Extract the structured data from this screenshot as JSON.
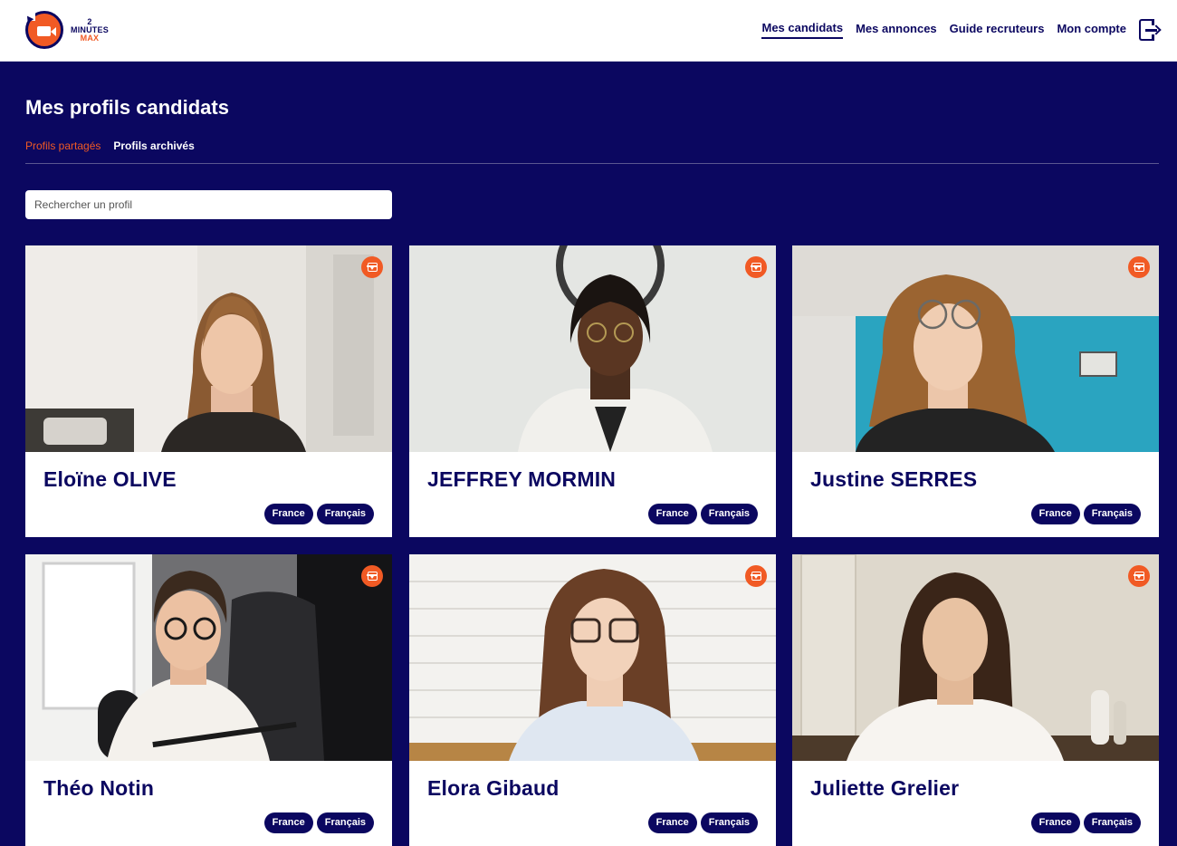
{
  "brand": {
    "logo_top": "2",
    "logo_mid": "MINUTES",
    "logo_bottom": "MAX",
    "accent": "#f15a24",
    "navy": "#0b0760"
  },
  "nav": {
    "items": [
      {
        "label": "Mes candidats",
        "active": true
      },
      {
        "label": "Mes annonces",
        "active": false
      },
      {
        "label": "Guide recruteurs",
        "active": false
      },
      {
        "label": "Mon compte",
        "active": false
      }
    ],
    "logout_icon": "logout-icon"
  },
  "page": {
    "title": "Mes profils candidats",
    "tabs": [
      {
        "label": "Profils partagés",
        "active": true
      },
      {
        "label": "Profils archivés",
        "active": false
      }
    ]
  },
  "search": {
    "placeholder": "Rechercher un profil",
    "value": ""
  },
  "candidates": [
    {
      "name": "Eloïne OLIVE",
      "tags": [
        "France",
        "Français"
      ],
      "archive_icon": "archive-icon"
    },
    {
      "name": "JEFFREY MORMIN",
      "tags": [
        "France",
        "Français"
      ],
      "archive_icon": "archive-icon"
    },
    {
      "name": "Justine SERRES",
      "tags": [
        "France",
        "Français"
      ],
      "archive_icon": "archive-icon"
    },
    {
      "name": "Théo Notin",
      "tags": [
        "France",
        "Français"
      ],
      "archive_icon": "archive-icon"
    },
    {
      "name": "Elora Gibaud",
      "tags": [
        "France",
        "Français"
      ],
      "archive_icon": "archive-icon"
    },
    {
      "name": "Juliette Grelier",
      "tags": [
        "France",
        "Français"
      ],
      "archive_icon": "archive-icon"
    }
  ]
}
